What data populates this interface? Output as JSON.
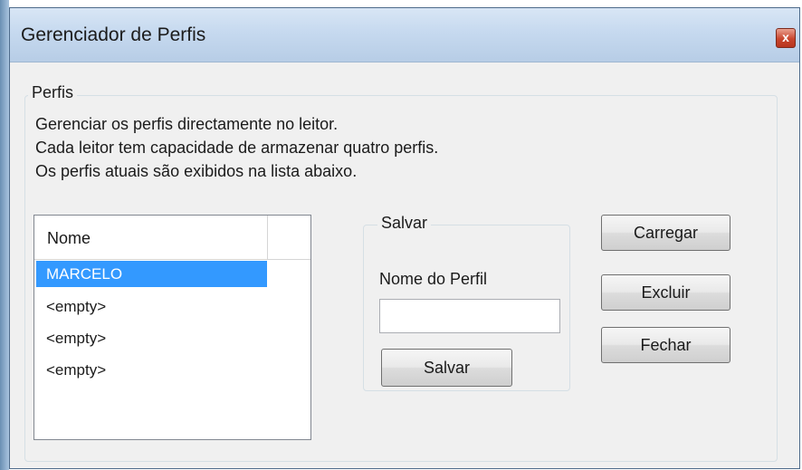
{
  "window": {
    "title": "Gerenciador de Perfis",
    "close_label": "x"
  },
  "profiles_group": {
    "legend": "Perfis",
    "description": [
      "Gerenciar os perfis directamente no leitor.",
      "Cada leitor tem capacidade de armazenar quatro perfis.",
      "Os perfis atuais são exibidos na lista abaixo."
    ]
  },
  "list": {
    "column_header": "Nome",
    "rows": [
      {
        "name": "MARCELO",
        "selected": true
      },
      {
        "name": "<empty>",
        "selected": false
      },
      {
        "name": "<empty>",
        "selected": false
      },
      {
        "name": "<empty>",
        "selected": false
      }
    ]
  },
  "save_group": {
    "legend": "Salvar",
    "field_label": "Nome do Perfil",
    "field_value": "",
    "button_label": "Salvar"
  },
  "actions": {
    "load_label": "Carregar",
    "delete_label": "Excluir",
    "close_label": "Fechar"
  },
  "colors": {
    "selection": "#3399ff",
    "titlebar": "#c6d9ef",
    "close_button": "#c9452d"
  }
}
